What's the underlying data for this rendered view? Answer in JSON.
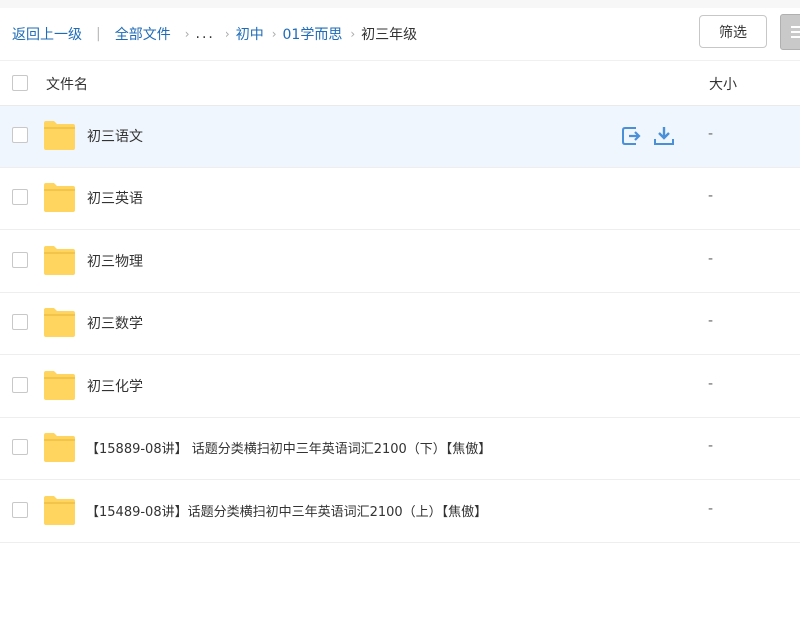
{
  "breadcrumb": {
    "back": "返回上一级",
    "all_files": "全部文件",
    "ellipsis": "...",
    "path": [
      "初中",
      "01学而思"
    ],
    "current": "初三年级"
  },
  "toolbar": {
    "filter_label": "筛选"
  },
  "table": {
    "col_name": "文件名",
    "col_size": "大小",
    "rows": [
      {
        "name": "初三语文",
        "size": "-"
      },
      {
        "name": "初三英语",
        "size": "-"
      },
      {
        "name": "初三物理",
        "size": "-"
      },
      {
        "name": "初三数学",
        "size": "-"
      },
      {
        "name": "初三化学",
        "size": "-"
      },
      {
        "name": "【15889-08讲】 话题分类横扫初中三年英语词汇2100（下）【焦傲】",
        "size": "-"
      },
      {
        "name": "【15489-08讲】话题分类横扫初中三年英语词汇2100（上）【焦傲】",
        "size": "-"
      }
    ]
  },
  "icons": {
    "row_actions": [
      "move-to-icon",
      "download-icon"
    ],
    "item": "folder-icon"
  },
  "colors": {
    "link": "#1e6bb8",
    "folder": "#ffd560",
    "row_hover": "#f0f6fd",
    "action_icon": "#4a90d9"
  }
}
